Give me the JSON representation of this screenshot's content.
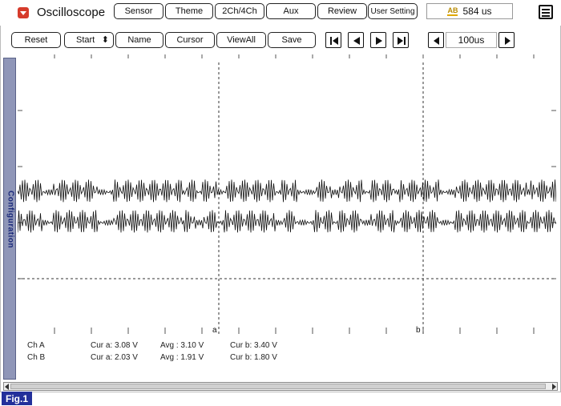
{
  "app": {
    "title": "Oscilloscope"
  },
  "toolbar": {
    "tabs": [
      "Sensor",
      "Theme",
      "2Ch/4Ch",
      "Aux",
      "Review",
      "User Setting"
    ],
    "time_readout": "584 us",
    "time_icon": "ab-cursor-icon"
  },
  "controls": {
    "buttons": [
      "Reset",
      "Start",
      "Name",
      "Cursor",
      "ViewAll",
      "Save"
    ],
    "start_arrows": "⬍",
    "transport": [
      "first-icon",
      "prev-icon",
      "next-icon",
      "last-icon"
    ],
    "zoom_value": "100us"
  },
  "sidebar": {
    "label": "Configuration"
  },
  "cursors": {
    "a_label": "a",
    "b_label": "b"
  },
  "readouts": [
    {
      "channel": "Ch A",
      "cur_a": "Cur a: 3.08 V",
      "avg": "Avg : 3.10 V",
      "cur_b": "Cur b: 3.40 V"
    },
    {
      "channel": "Ch B",
      "cur_a": "Cur a: 2.03 V",
      "avg": "Avg : 1.91 V",
      "cur_b": "Cur b: 1.80 V"
    }
  ],
  "figure_label": "Fig.1",
  "colors": {
    "accent": "#d63b2b",
    "sidebar": "#8f96b8",
    "fig_badge": "#23309b",
    "trace": "#111111"
  }
}
